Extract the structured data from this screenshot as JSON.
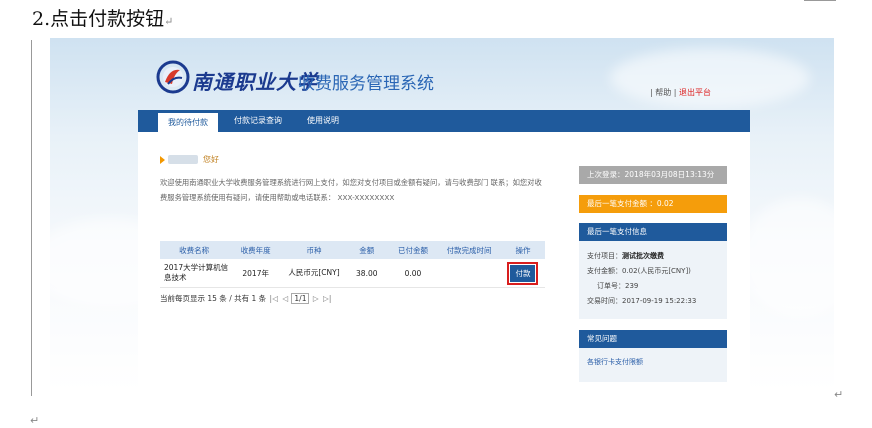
{
  "doc": {
    "heading": "2.点击付款按钮",
    "para_mark": "↵",
    "return_mark": "↵"
  },
  "site": {
    "school_name": "南通职业大学",
    "system_title": "收费服务管理系统",
    "help_link": "帮助",
    "exit_link": "退出平台"
  },
  "nav": {
    "tabs": [
      "我的待付款",
      "付款记录查询",
      "使用说明"
    ]
  },
  "main": {
    "greeting": "您好",
    "welcome_text": "欢迎使用南通职业大学收费服务管理系统进行网上支付，如您对支付项目或金额有疑问，请与收费部门 联系；如您对收费服务管理系统使用有疑问，请使用帮助或电话联系： XXX-XXXXXXXX",
    "table": {
      "headers": [
        "收费名称",
        "收费年度",
        "币种",
        "金额",
        "已付金额",
        "付款完成时间",
        "操作"
      ],
      "rows": [
        {
          "name": "2017大学计算机信息技术",
          "year": "2017年",
          "currency": "人民币元[CNY]",
          "amount": "38.00",
          "paid": "0.00",
          "completed_time": "",
          "action": "付款"
        }
      ]
    },
    "pager": {
      "summary": "当前每页显示 15 条 / 共有 1 条",
      "page_value": "1/1",
      "first": "|◁",
      "prev": "◁",
      "next": "▷",
      "last": "▷|"
    }
  },
  "sidebar": {
    "last_login": "上次登录：2018年03月08日13:13分",
    "last_payment": "最后一笔支付金额 ：0.02",
    "last_info_title": "最后一笔支付信息",
    "last_info": {
      "item_label": "支付项目：",
      "item_value": "测试批次缴费",
      "amount_label": "支付金额：",
      "amount_value": "0.02(人民币元[CNY])",
      "order_label": "订单号：",
      "order_value": "239",
      "time_label": "交易时间：",
      "time_value": "2017-09-19 15:22:33"
    },
    "faq_title": "常见问题",
    "faq_link": "各银行卡支付限额"
  },
  "colors": {
    "nav_blue": "#1f5a9c",
    "accent_orange": "#f59d0b",
    "highlight_red": "#d81e1e"
  }
}
